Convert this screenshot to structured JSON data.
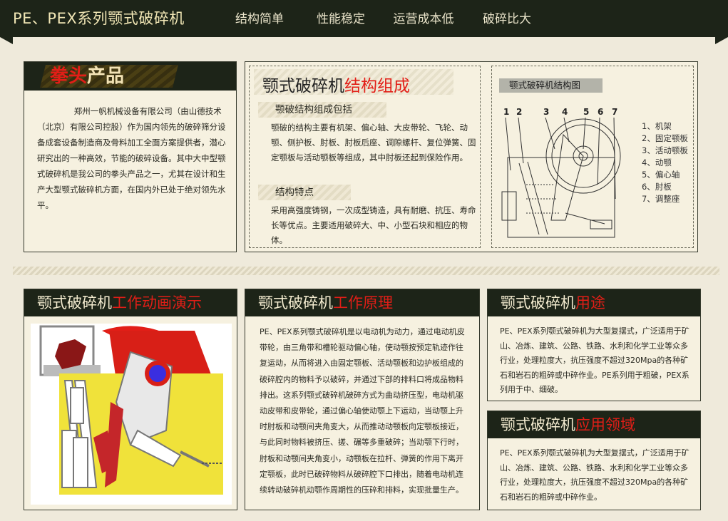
{
  "header": {
    "title": "PE、PEX系列颚式破碎机",
    "tags": [
      "结构简单",
      "性能稳定",
      "运营成本低",
      "破碎比大"
    ]
  },
  "fist_product": {
    "title_hl": "拳头",
    "title_rest": "产品",
    "body": "郑州一帆机械设备有限公司（由山德技术（北京）有限公司控股）作为国内领先的破碎筛分设备成套设备制造商及骨料加工全面方案提供者，潜心研究出的一种高效，节能的破碎设备。其中大中型颚式破碎机是我公司的拳头产品之一，尤其在设计和生产大型颚式破碎机方面，在国内外已处于绝对领先水平。"
  },
  "structure": {
    "title_main": "颚式破碎机",
    "title_hl": "结构组成",
    "sub1": "颚破结构组成包括",
    "text1": "颚破的结构主要有机架、偏心轴、大皮带轮、飞轮、动颚、侧护板、肘板、肘板后座、调隙螺杆、复位弹簧、固定颚板与活动颚板等组成，其中肘板还起到保险作用。",
    "sub2": "结构特点",
    "text2": "采用高强度铸钢，一次成型铸造，具有耐磨、抗压、寿命长等优点。主要适用破碎大、中、小型石块和相应的物体。",
    "diagram_label": "颚式破碎机结构图",
    "diagram_numbers": [
      "1",
      "2",
      "3",
      "4",
      "5",
      "6",
      "7"
    ],
    "legend": [
      "1、机架",
      "2、固定颚板",
      "3、活动颚板",
      "4、动颚",
      "5、偏心轴",
      "6、肘板",
      "7、调整座"
    ]
  },
  "animation": {
    "title_main": "颚式破碎机",
    "title_hl": "工作动画演示"
  },
  "principle": {
    "title_main": "颚式破碎机",
    "title_hl": "工作原理",
    "body": "PE、PEX系列颚式破碎机是以电动机为动力，通过电动机皮带轮，由三角带和槽轮驱动偏心轴，使动颚按预定轨迹作往复运动，从而将进入由固定颚板、活动颚板和边护板组成的破碎腔内的物料予以破碎，并通过下部的排料口将成品物料排出。这系列颚式破碎机破碎方式为曲动挤压型，电动机驱动皮带和皮带轮，通过偏心轴使动颚上下运动，当动颚上升时肘板和动颚间夹角变大，从而推动动颚板向定颚板接近，与此同时物料被挤压、搓、碾等多重破碎；当动颚下行时，肘板和动颚间夹角变小，动颚板在拉杆、弹簧的作用下离开定颚板，此时已破碎物料从破碎腔下口排出，随着电动机连续转动破碎机动颚作周期性的压碎和排料，实现批量生产。"
  },
  "usage": {
    "title_main": "颚式破碎机",
    "title_hl": "用途",
    "body": "PE、PEX系列颚式破碎机为大型复摆式，广泛适用于矿山、冶炼、建筑、公路、铁路、水利和化学工业等众多行业，处理粒度大，抗压强度不超过320Mpa的各种矿石和岩石的粗碎或中碎作业。PE系列用于粗破，PEX系列用于中、细破。"
  },
  "field": {
    "title_main": "颚式破碎机",
    "title_hl": "应用领域",
    "body": "PE、PEX系列颚式破碎机为大型复摆式，广泛适用于矿山、冶炼、建筑、公路、铁路、水利和化学工业等众多行业，处理粒度大，抗压强度不超过320Mpa的各种矿石和岩石的粗碎或中碎作业。"
  }
}
